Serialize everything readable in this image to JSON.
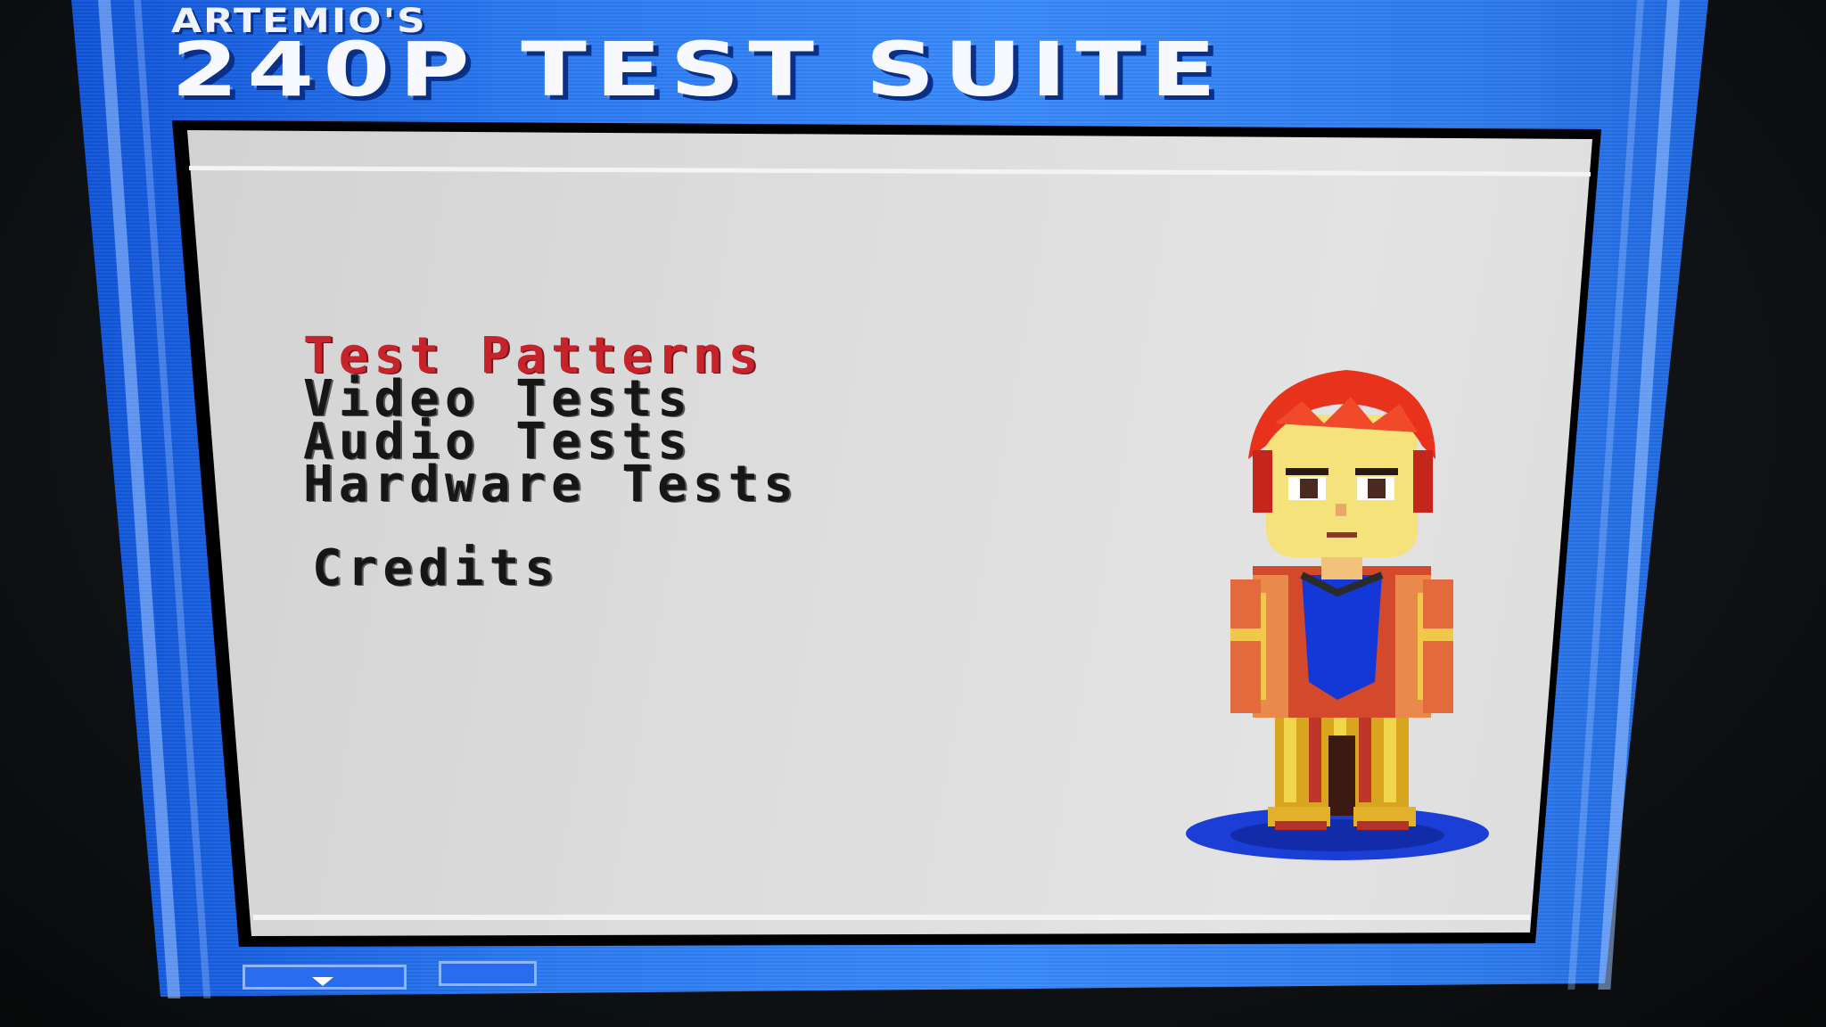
{
  "header": {
    "subtitle": "ARTEMIO'S",
    "title": "240P TEST SUITE"
  },
  "menu": {
    "items": [
      {
        "label": "Test Patterns",
        "selected": true
      },
      {
        "label": "Video Tests",
        "selected": false
      },
      {
        "label": "Audio Tests",
        "selected": false
      },
      {
        "label": "Hardware Tests",
        "selected": false
      }
    ],
    "credits_label": "Credits"
  },
  "colors": {
    "frame_blue": "#2f7ef2",
    "panel_gray": "#dcdcdc",
    "menu_text": "#161616",
    "menu_selected": "#c7232a"
  },
  "icons": {
    "character": "pixel-character-sprite",
    "tab_arrow": "chevron-down-icon"
  }
}
